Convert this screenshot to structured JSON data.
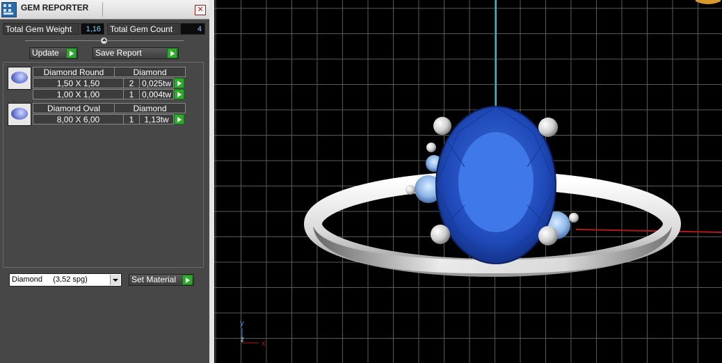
{
  "window": {
    "title": "GEM REPORTER",
    "close_glyph": "✕"
  },
  "summary": {
    "weight_label": "Total Gem Weight",
    "weight_value": "1,16",
    "count_label": "Total Gem Count",
    "count_value": "4"
  },
  "toolbar": {
    "update_label": "Update",
    "save_label": "Save Report"
  },
  "gems": [
    {
      "shape": "Diamond Round",
      "material": "Diamond",
      "rows": [
        {
          "size": "1,50 X 1,50",
          "qty": "2",
          "weight": "0,025tw"
        },
        {
          "size": "1,00 X 1,00",
          "qty": "1",
          "weight": "0,004tw"
        }
      ]
    },
    {
      "shape": "Diamond Oval",
      "material": "Diamond",
      "rows": [
        {
          "size": "8,00 X 6,00",
          "qty": "1",
          "weight": "1,13tw"
        }
      ]
    }
  ],
  "footer": {
    "material_select": "Diamond     (3,52 spg)",
    "set_material_label": "Set Material"
  },
  "viewport": {
    "axis_y": "y",
    "axis_z": "z",
    "axis_x": "x"
  },
  "colors": {
    "gem": "#1f49b8",
    "metal": "#e6e6e6",
    "grid": "#5a5a5a",
    "go_button": "#2faa2f"
  }
}
